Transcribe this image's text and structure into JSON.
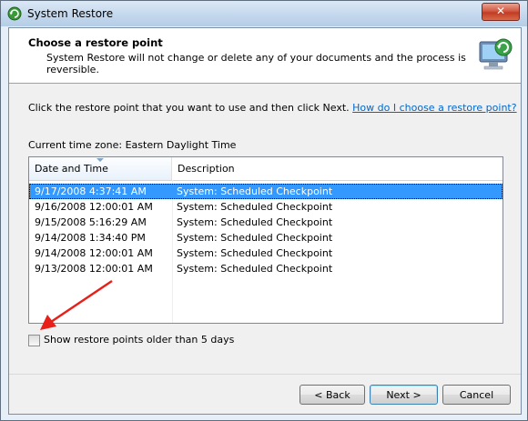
{
  "window": {
    "title": "System Restore",
    "close_label": "✕"
  },
  "header": {
    "title": "Choose a restore point",
    "subtitle": "System Restore will not change or delete any of your documents and the process is reversible."
  },
  "instructions": {
    "text": "Click the restore point that you want to use and then click Next.",
    "link": "How do I choose a restore point?"
  },
  "timezone": "Current time zone: Eastern Daylight Time",
  "table": {
    "columns": [
      "Date and Time",
      "Description"
    ],
    "rows": [
      {
        "date": "9/17/2008 4:37:41 AM",
        "desc": "System: Scheduled Checkpoint"
      },
      {
        "date": "9/16/2008 12:00:01 AM",
        "desc": "System: Scheduled Checkpoint"
      },
      {
        "date": "9/15/2008 5:16:29 AM",
        "desc": "System: Scheduled Checkpoint"
      },
      {
        "date": "9/14/2008 1:34:40 PM",
        "desc": "System: Scheduled Checkpoint"
      },
      {
        "date": "9/14/2008 12:00:01 AM",
        "desc": "System: Scheduled Checkpoint"
      },
      {
        "date": "9/13/2008 12:00:01 AM",
        "desc": "System: Scheduled Checkpoint"
      }
    ],
    "selected_index": 0
  },
  "checkbox": {
    "label": "Show restore points older than 5 days",
    "checked": false
  },
  "buttons": {
    "back": "< Back",
    "next": "Next >",
    "cancel": "Cancel"
  },
  "colors": {
    "selection": "#3399ff",
    "link": "#0066cc",
    "arrow": "#e8201a"
  },
  "icons": {
    "title": "system-restore-icon",
    "header": "monitor-restore-icon"
  }
}
